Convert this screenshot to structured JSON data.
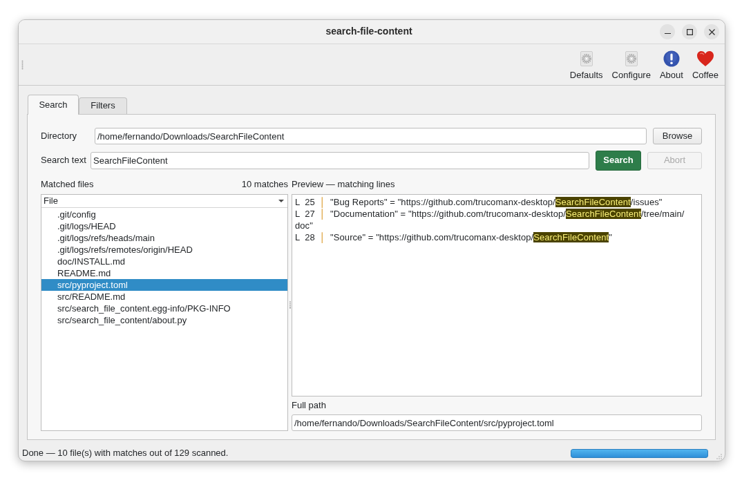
{
  "window": {
    "title": "search-file-content"
  },
  "toolbar": [
    {
      "label": "Defaults",
      "kind": "gear"
    },
    {
      "label": "Configure",
      "kind": "gear"
    },
    {
      "label": "About",
      "kind": "alert"
    },
    {
      "label": "Coffee",
      "kind": "heart"
    }
  ],
  "tabs": [
    {
      "label": "Search",
      "selected": true
    },
    {
      "label": "Filters",
      "selected": false
    }
  ],
  "directory": {
    "label": "Directory",
    "value": "/home/fernando/Downloads/SearchFileContent",
    "button": "Browse"
  },
  "search_text": {
    "label": "Search text",
    "value": "SearchFileContent"
  },
  "search_button": {
    "label": "Search"
  },
  "abort_button": {
    "label": "Abort",
    "disabled": true
  },
  "matched_files": {
    "label": "Matched files",
    "count": "10 matches",
    "column": "File",
    "items": [
      {
        "path": ".git/config",
        "selected": false
      },
      {
        "path": ".git/logs/HEAD",
        "selected": false
      },
      {
        "path": ".git/logs/refs/heads/main",
        "selected": false
      },
      {
        "path": ".git/logs/refs/remotes/origin/HEAD",
        "selected": false
      },
      {
        "path": "doc/INSTALL.md",
        "selected": false
      },
      {
        "path": "README.md",
        "selected": false
      },
      {
        "path": "src/pyproject.toml",
        "selected": true
      },
      {
        "path": "src/README.md",
        "selected": false
      },
      {
        "path": "src/search_file_content.egg-info/PKG-INFO",
        "selected": false
      },
      {
        "path": "src/search_file_content/about.py",
        "selected": false
      }
    ]
  },
  "preview": {
    "label": "Preview — matching lines",
    "lines": [
      {
        "line": "L  25",
        "separator": "│",
        "before": "\"Bug Reports\" = \"https://github.com/trucomanx-desktop/",
        "match": "SearchFileContent",
        "after": "/issues\""
      },
      {
        "line": "L  27",
        "separator": "│",
        "before": "\"Documentation\" = \"https://github.com/trucomanx-desktop/",
        "match": "SearchFileContent",
        "after": "/tree/main/doc\""
      },
      {
        "line": "L  28",
        "separator": "│",
        "before": "\"Source\" = \"https://github.com/trucomanx-desktop/",
        "match": "SearchFileContent",
        "after": "\""
      }
    ]
  },
  "full_path": {
    "label": "Full path",
    "value": "/home/fernando/Downloads/SearchFileContent/src/pyproject.toml"
  },
  "status_bar": {
    "message": "Done — 10 file(s) with matches out of 129 scanned.",
    "progress": {
      "level": 1
    }
  }
}
